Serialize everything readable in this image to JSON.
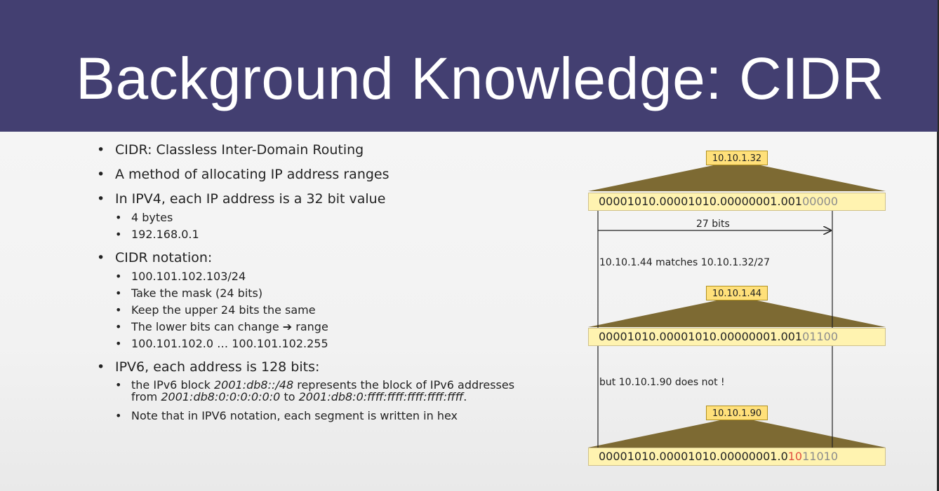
{
  "title": "Background Knowledge: CIDR",
  "bullets": {
    "b1": "CIDR: Classless Inter-Domain Routing",
    "b2": "A method of allocating IP address ranges",
    "b3": "In IPV4, each IP address is a 32 bit value",
    "b3_sub": [
      "4 bytes",
      "192.168.0.1"
    ],
    "b4": "CIDR notation:",
    "b4_sub": [
      "100.101.102.103/24",
      "Take the mask (24 bits)",
      "Keep the upper 24 bits the same",
      "The lower bits can change",
      "100.101.102.0 … 100.101.102.255"
    ],
    "b4_sub3_suffix": "range",
    "b5": "IPV6, each address is 128 bits:",
    "b5_sub1": {
      "a": "the IPv6 block ",
      "b": "2001:db8::/48",
      "c": " represents the block of IPv6 addresses from ",
      "d": "2001:db8:0:0:0:0:0:0",
      "e": " to ",
      "f": "2001:db8:0:ffff:ffff:ffff:ffff:ffff",
      "g": "."
    },
    "b5_sub2": "Note that in IPV6 notation, each segment is written in hex"
  },
  "diagram": {
    "block1": {
      "label": "10.10.1.32",
      "bits_prefix": "00001010.00001010.00000001.001",
      "bits_suffix": "00000"
    },
    "mask_label": "27 bits",
    "match_note": "10.10.1.44 matches 10.10.1.32/27",
    "block2": {
      "label": "10.10.1.44",
      "bits_prefix": "00001010.00001010.00000001.001",
      "bits_suffix": "01100"
    },
    "nomatch_note": "but 10.10.1.90 does not !",
    "block3": {
      "label": "10.10.1.90",
      "bits_prefix": "00001010.00001010.00000001.0",
      "bits_diff": "10",
      "bits_suffix": "11010"
    },
    "colors": {
      "triangle": "#7d6a33",
      "label_bg": "#ffe07a",
      "bits_bg": "#fff3b0",
      "diff": "#e05040"
    }
  }
}
